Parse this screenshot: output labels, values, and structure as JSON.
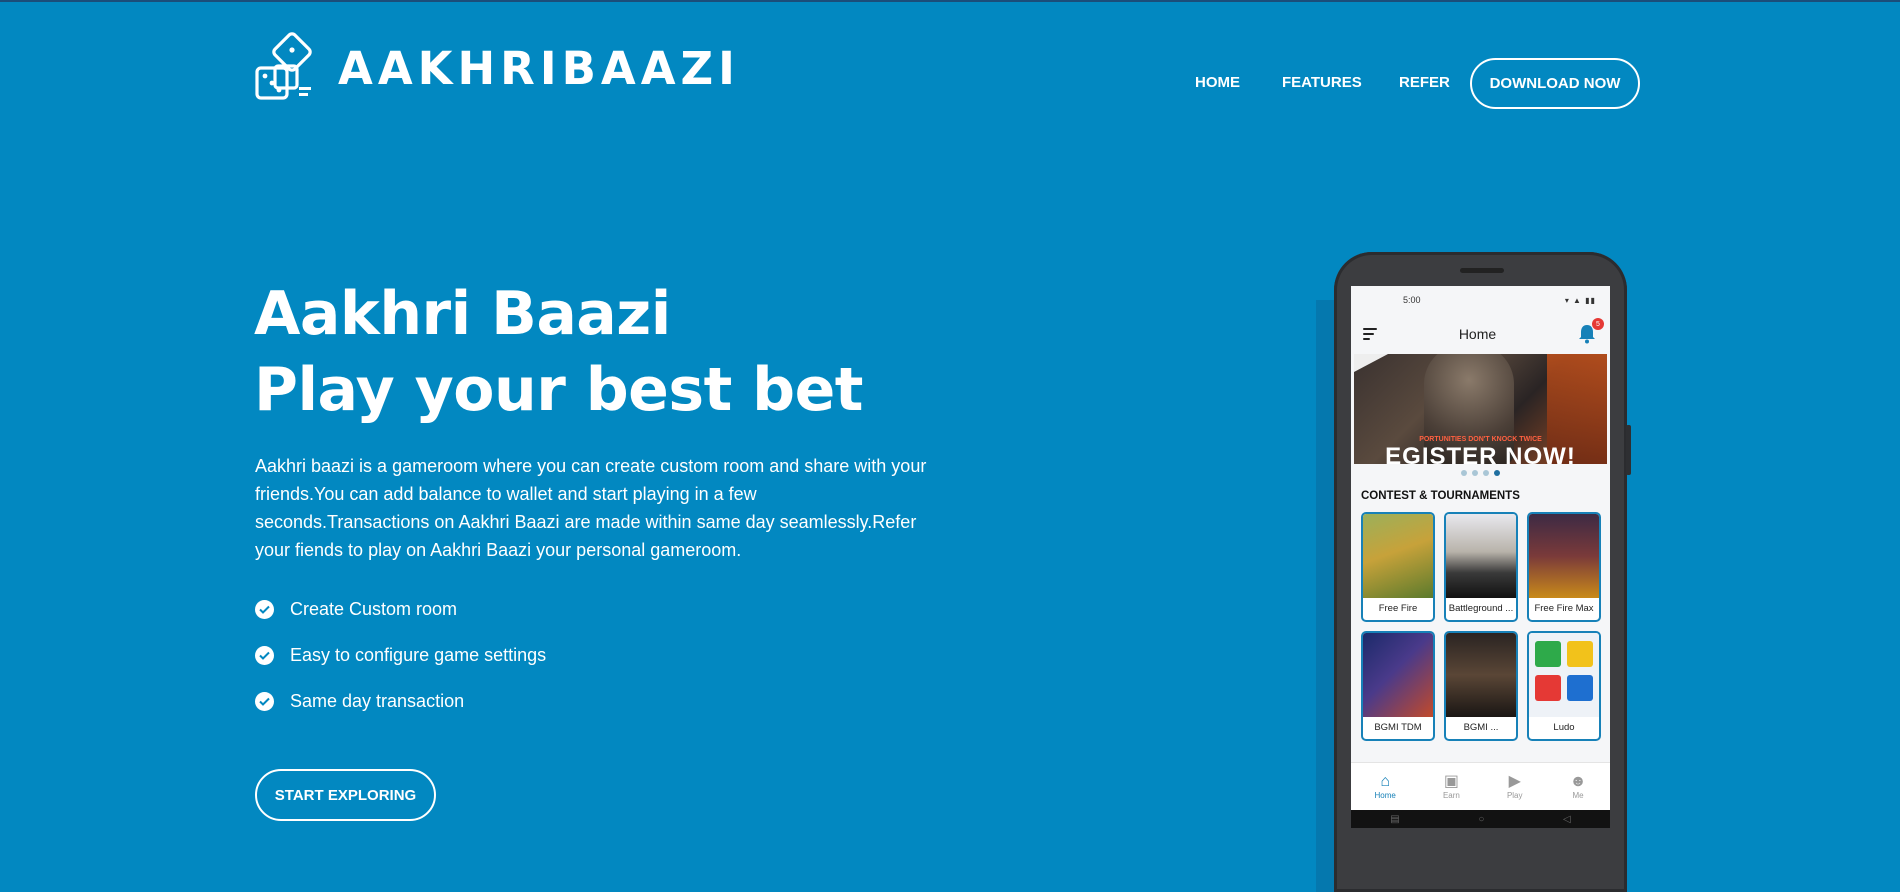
{
  "brand": {
    "name": "AAKHRIBAAZI"
  },
  "nav": {
    "home": "HOME",
    "features": "FEATURES",
    "refer": "REFER",
    "download": "DOWNLOAD NOW"
  },
  "hero": {
    "title_line1": "Aakhri Baazi",
    "title_line2": "Play your best bet",
    "description": "Aakhri baazi is a gameroom where you can create custom room and share with your friends.You can add balance to wallet and start playing in a few seconds.Transactions on Aakhri Baazi are made within same day seamlessly.Refer your fiends to play on Aakhri Baazi your personal gameroom.",
    "features": [
      "Create Custom room",
      "Easy to configure game settings",
      "Same day transaction"
    ],
    "cta": "START EXPLORING"
  },
  "phone": {
    "status_time": "5:00",
    "appbar_title": "Home",
    "notification_count": "5",
    "banner_strip": "PORTUNITIES DON'T KNOCK TWICE",
    "banner_big": "EGISTER NOW!",
    "section_title": "CONTEST & TOURNAMENTS",
    "games": [
      {
        "label": "Free Fire"
      },
      {
        "label": "Battleground ..."
      },
      {
        "label": "Free Fire Max"
      },
      {
        "label": "BGMI TDM"
      },
      {
        "label": "BGMI ..."
      },
      {
        "label": "Ludo"
      }
    ],
    "bottom_nav": [
      {
        "label": "Home",
        "icon": "home-icon"
      },
      {
        "label": "Earn",
        "icon": "gift-icon"
      },
      {
        "label": "Play",
        "icon": "play-icon"
      },
      {
        "label": "Me",
        "icon": "smiley-icon"
      }
    ]
  },
  "colors": {
    "background": "#0288c1",
    "accent": "#1781b8",
    "badge": "#e53935"
  }
}
